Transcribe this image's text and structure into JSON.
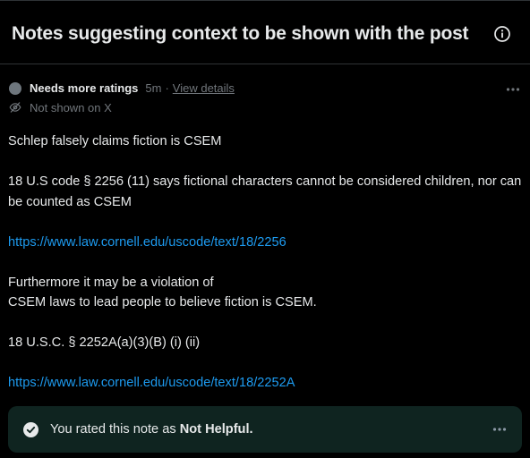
{
  "header": {
    "title": "Notes suggesting context to be shown with the post",
    "info_icon": "info-icon"
  },
  "note": {
    "status_label": "Needs more ratings",
    "age": "5m",
    "separator": "·",
    "view_details": "View details",
    "visibility": "Not shown on X",
    "paragraphs": {
      "p1": "Schlep falsely claims fiction is CSEM",
      "p2": "18 U.S code § 2256 (11) says fictional characters cannot be considered children, nor can be counted as CSEM",
      "link1": "https://www.law.cornell.edu/uscode/text/18/2256",
      "p3_line1": "Furthermore it may be a violation of",
      "p3_line2": "CSEM laws to lead people to believe fiction is CSEM.",
      "p4": "18 U.S.C. § 2252A(a)(3)(B) (i) (ii)",
      "link2": "https://www.law.cornell.edu/uscode/text/18/2252A"
    }
  },
  "rating": {
    "prefix": "You rated this note as ",
    "value": "Not Helpful",
    "suffix": "."
  },
  "colors": {
    "background": "#000000",
    "text": "#e7e9ea",
    "muted": "#71767b",
    "link": "#1d9bf0",
    "rated_bg": "#0f2420"
  }
}
